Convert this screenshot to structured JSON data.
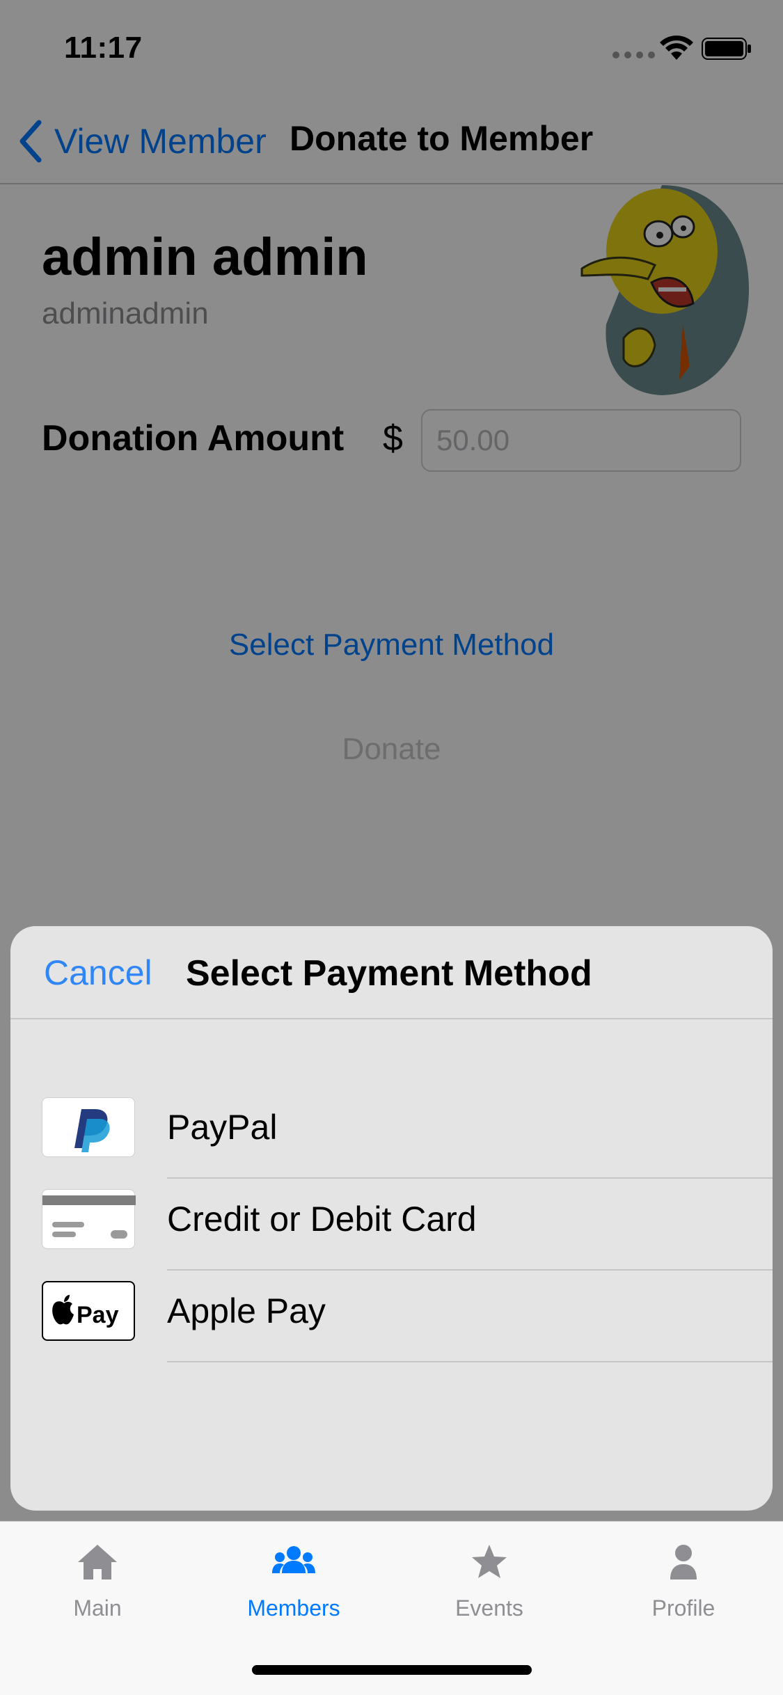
{
  "status_bar": {
    "time": "11:17"
  },
  "nav": {
    "back_label": "View Member",
    "title": "Donate to Member"
  },
  "member": {
    "full_name": "admin admin",
    "username": "adminadmin"
  },
  "donation": {
    "amount_label": "Donation Amount",
    "currency_symbol": "$",
    "amount_placeholder": "50.00",
    "select_method_label": "Select Payment Method",
    "donate_label": "Donate"
  },
  "sheet": {
    "cancel_label": "Cancel",
    "title": "Select Payment Method",
    "methods": [
      {
        "label": "PayPal",
        "icon": "paypal-icon"
      },
      {
        "label": "Credit or Debit Card",
        "icon": "credit-card-icon"
      },
      {
        "label": "Apple Pay",
        "icon": "apple-pay-icon"
      }
    ]
  },
  "tabs": [
    {
      "label": "Main",
      "icon": "home-icon",
      "active": false
    },
    {
      "label": "Members",
      "icon": "members-icon",
      "active": true
    },
    {
      "label": "Events",
      "icon": "star-icon",
      "active": false
    },
    {
      "label": "Profile",
      "icon": "person-icon",
      "active": false
    }
  ],
  "colors": {
    "accent": "#007aff",
    "sheet_background": "#e4e4e4",
    "inactive_tab": "#8e8e93",
    "paypal_dark": "#253b80",
    "paypal_light": "#179bd7"
  }
}
